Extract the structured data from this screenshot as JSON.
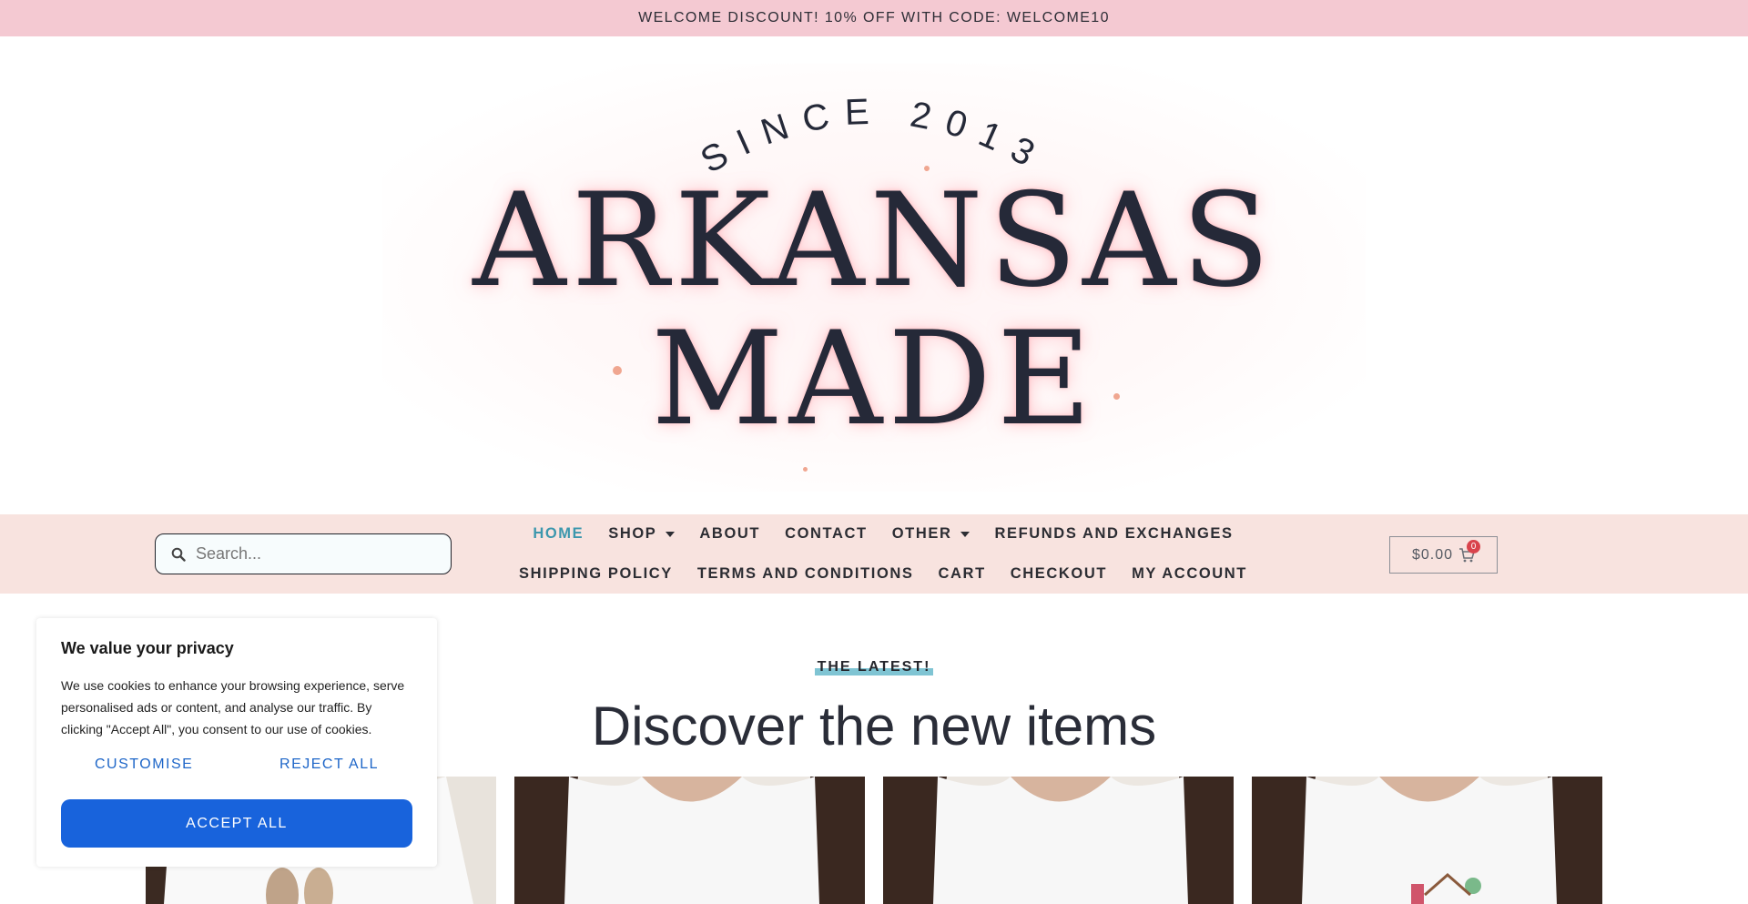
{
  "announcement": "WELCOME DISCOUNT! 10% OFF WITH CODE: WELCOME10",
  "logo": {
    "since": "SINCE 2013",
    "line1": "ARKANSAS",
    "line2": "MADE"
  },
  "search": {
    "placeholder": "Search...",
    "icon": "search-icon"
  },
  "nav": {
    "row1": [
      {
        "label": "HOME",
        "active": true
      },
      {
        "label": "SHOP",
        "dropdown": true
      },
      {
        "label": "ABOUT"
      },
      {
        "label": "CONTACT"
      },
      {
        "label": "OTHER",
        "dropdown": true
      },
      {
        "label": "REFUNDS AND EXCHANGES"
      }
    ],
    "row2": [
      {
        "label": "SHIPPING POLICY"
      },
      {
        "label": "TERMS AND CONDITIONS"
      },
      {
        "label": "CART"
      },
      {
        "label": "CHECKOUT"
      },
      {
        "label": "MY ACCOUNT"
      }
    ]
  },
  "cart": {
    "total": "$0.00",
    "count": "0",
    "icon": "cart-icon"
  },
  "section": {
    "eyebrow": "THE LATEST!",
    "heading": "Discover the new items"
  },
  "consent": {
    "title": "We value your privacy",
    "body": "We use cookies to enhance your browsing experience, serve personalised ads or content, and analyse our traffic. By clicking \"Accept All\", you consent to our use of cookies.",
    "customise": "CUSTOMISE",
    "reject": "REJECT ALL",
    "accept": "ACCEPT ALL"
  },
  "colors": {
    "announcement_bg": "#f4c9d2",
    "nav_bg": "#f8e3df",
    "active_link": "#3c97ad",
    "accept_button": "#1863dc",
    "highlight": "#7fc4d3"
  }
}
